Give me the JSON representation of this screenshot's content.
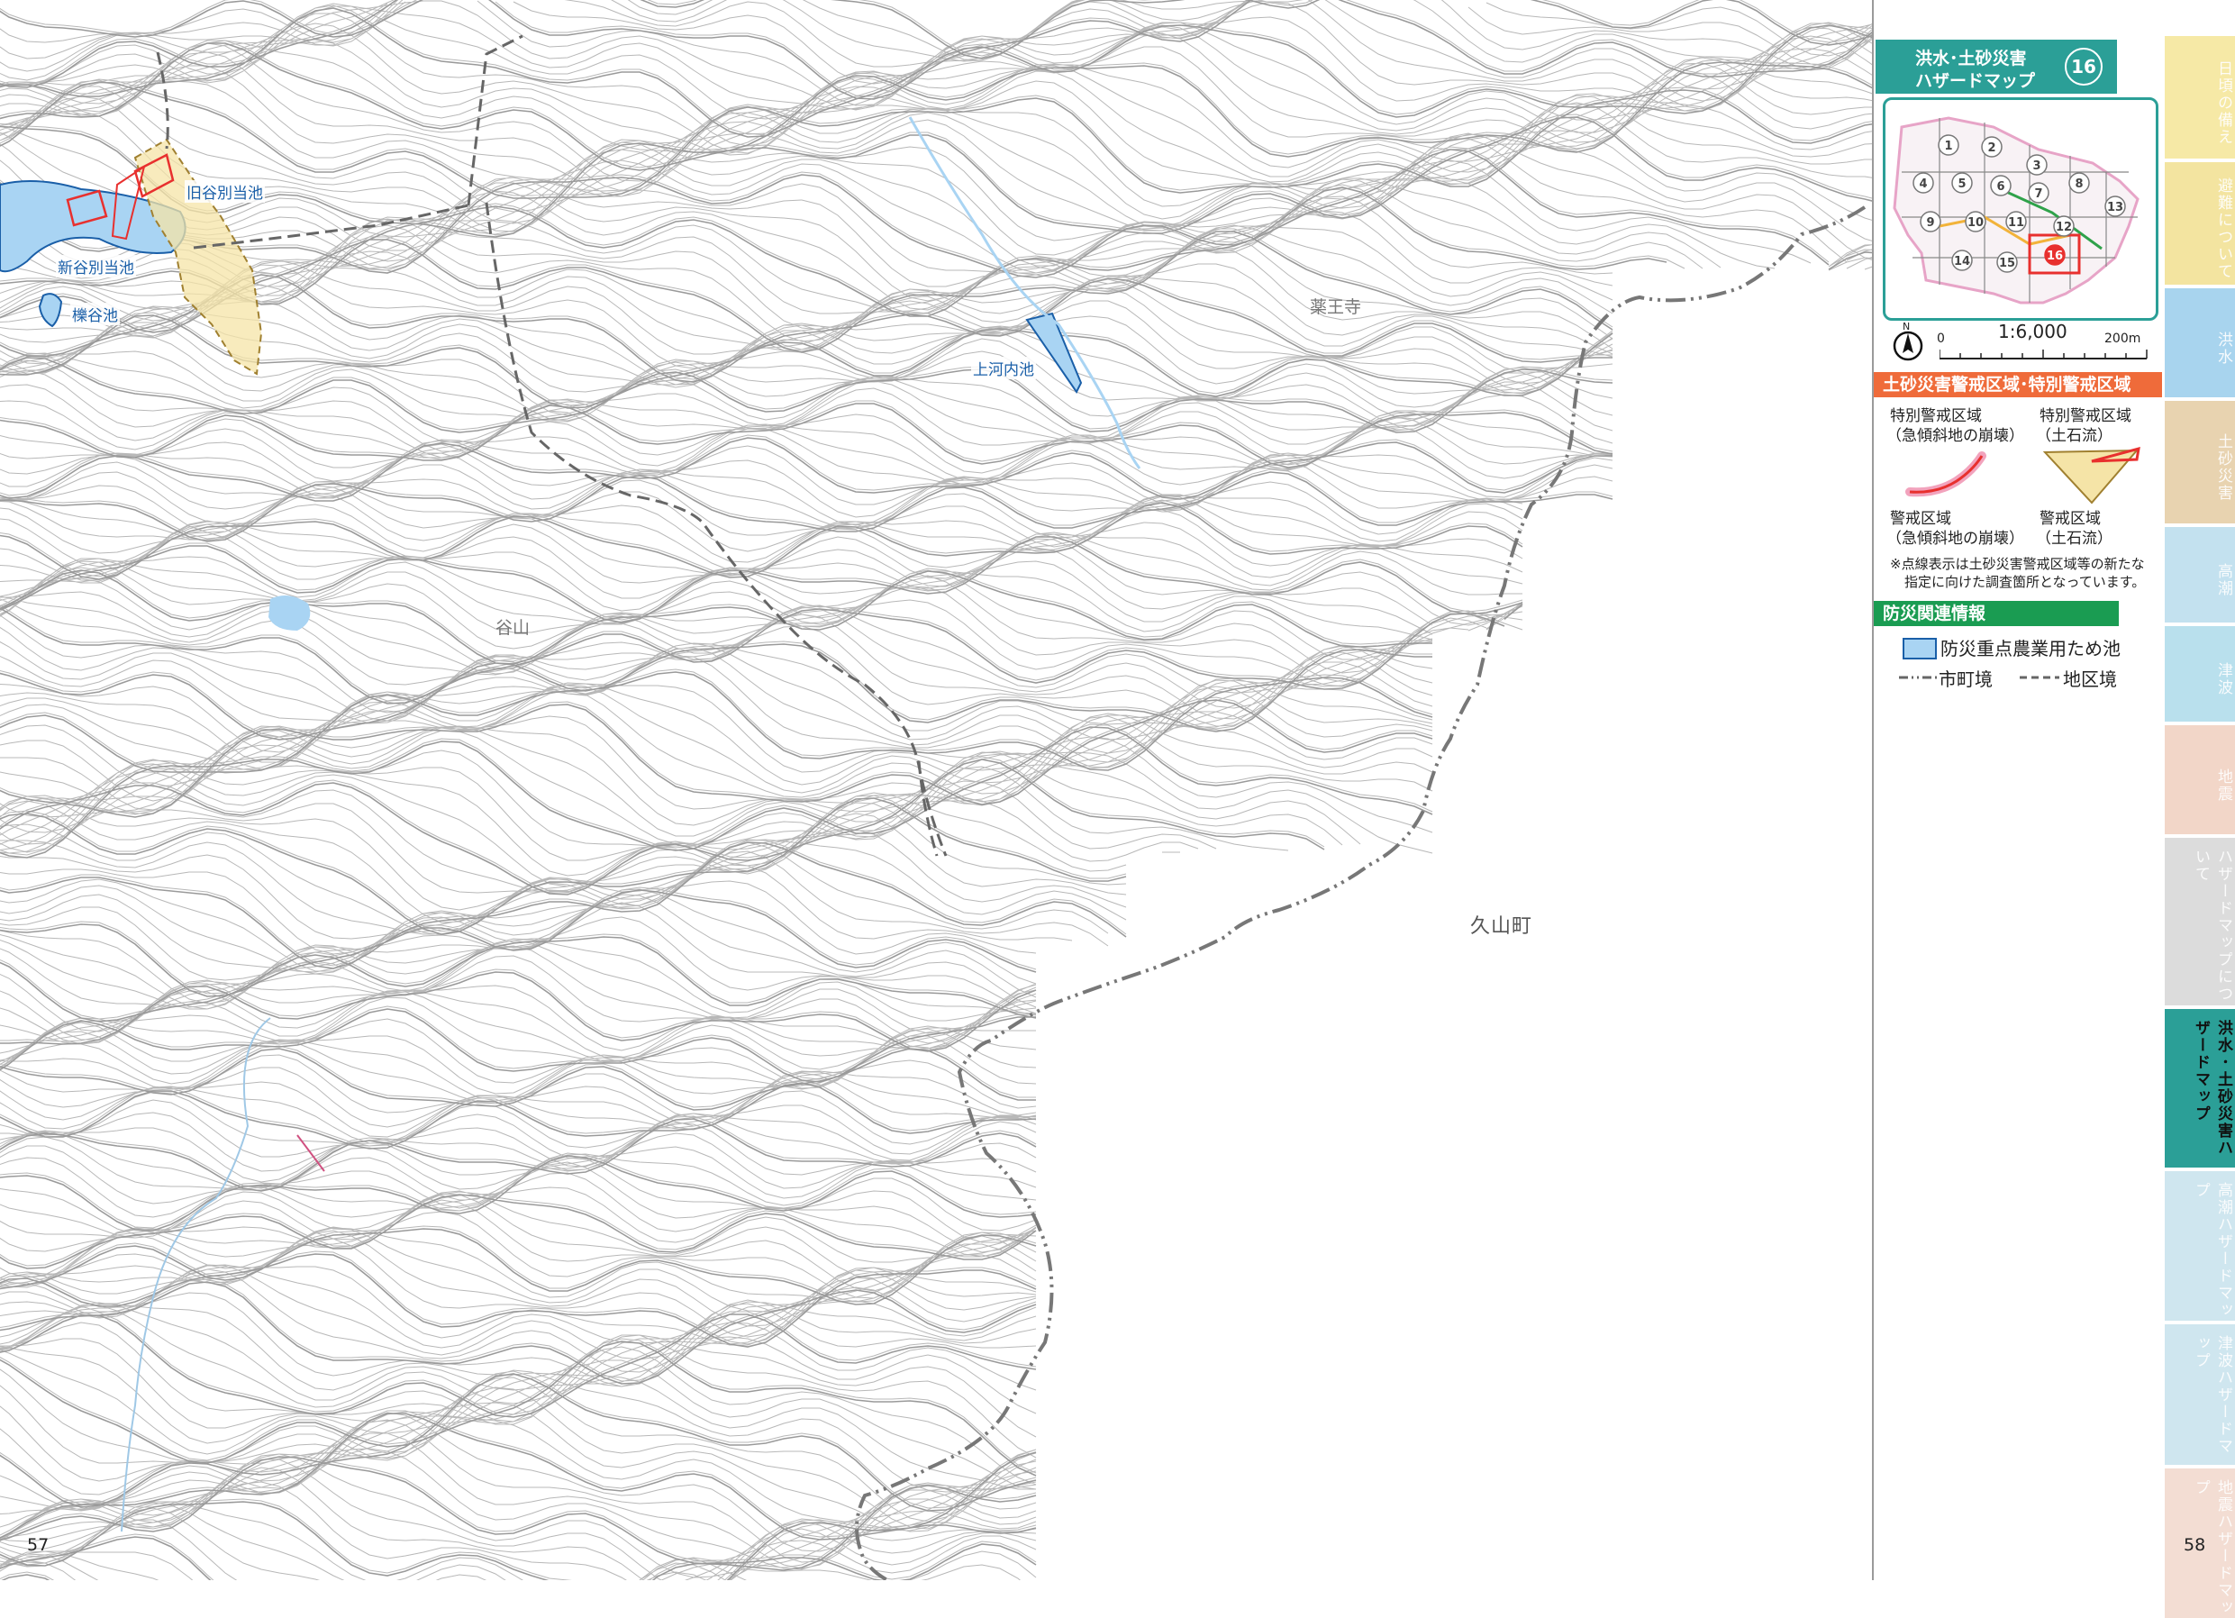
{
  "map": {
    "ponds": [
      {
        "label": "旧谷別当池"
      },
      {
        "label": "新谷別当池"
      },
      {
        "label": "櫟谷池"
      },
      {
        "label": "上河内池"
      }
    ],
    "places": [
      {
        "label": "薬王寺"
      },
      {
        "label": "谷山"
      }
    ],
    "town": "久山町"
  },
  "pages": {
    "left": "57",
    "right": "58"
  },
  "panel": {
    "title_line1": "洪水･土砂災害",
    "title_line2": "ハザードマップ",
    "map_number": "16",
    "index_map": {
      "cells": [
        "1",
        "2",
        "3",
        "4",
        "5",
        "6",
        "7",
        "8",
        "9",
        "10",
        "11",
        "12",
        "13",
        "14",
        "15",
        "16"
      ],
      "highlight": "16"
    },
    "scale": {
      "north": "N",
      "zero": "0",
      "ratio": "1:6,000",
      "max": "200m"
    },
    "sediment_section": {
      "title": "土砂災害警戒区域･特別警戒区域",
      "special_steep_line1": "特別警戒区域",
      "special_steep_line2": "（急傾斜地の崩壊）",
      "special_debris_line1": "特別警戒区域",
      "special_debris_line2": "（土石流）",
      "warning_steep_line1": "警戒区域",
      "warning_steep_line2": "（急傾斜地の崩壊）",
      "warning_debris_line1": "警戒区域",
      "warning_debris_line2": "（土石流）",
      "note_line1": "※点線表示は土砂災害警戒区域等の新たな",
      "note_line2": "指定に向けた調査箇所となっています。",
      "colors": {
        "special": "#e8302e",
        "warning": "#f2d774"
      }
    },
    "disaster_section": {
      "title": "防災関連情報",
      "pond_legend": "防災重点農業用ため池",
      "city_border": "市町境",
      "district_border": "地区境",
      "pond_color": "#a9d4f3"
    }
  },
  "tabs": [
    {
      "label": "日頃の備え",
      "color": "#f6e9a6"
    },
    {
      "label": "避難について",
      "color": "#f3e4a0"
    },
    {
      "label": "洪水",
      "color": "#a8d4ee"
    },
    {
      "label": "土砂災害",
      "color": "#e8d3b0"
    },
    {
      "label": "高潮",
      "color": "#c3e1ef"
    },
    {
      "label": "津波",
      "color": "#b9e0ed"
    },
    {
      "label": "地震",
      "color": "#f2d6c8"
    },
    {
      "label": "ハザードマップについて",
      "color": "#dcdcdc"
    },
    {
      "label": "洪水･土砂災害ハザードマップ",
      "color": "#2b9f97",
      "active": true
    },
    {
      "label": "高潮ハザードマップ",
      "color": "#cfe6ef"
    },
    {
      "label": "津波ハザードマップ",
      "color": "#cfe6ef"
    },
    {
      "label": "地震ハザードマップ",
      "color": "#f3ddd3"
    }
  ]
}
